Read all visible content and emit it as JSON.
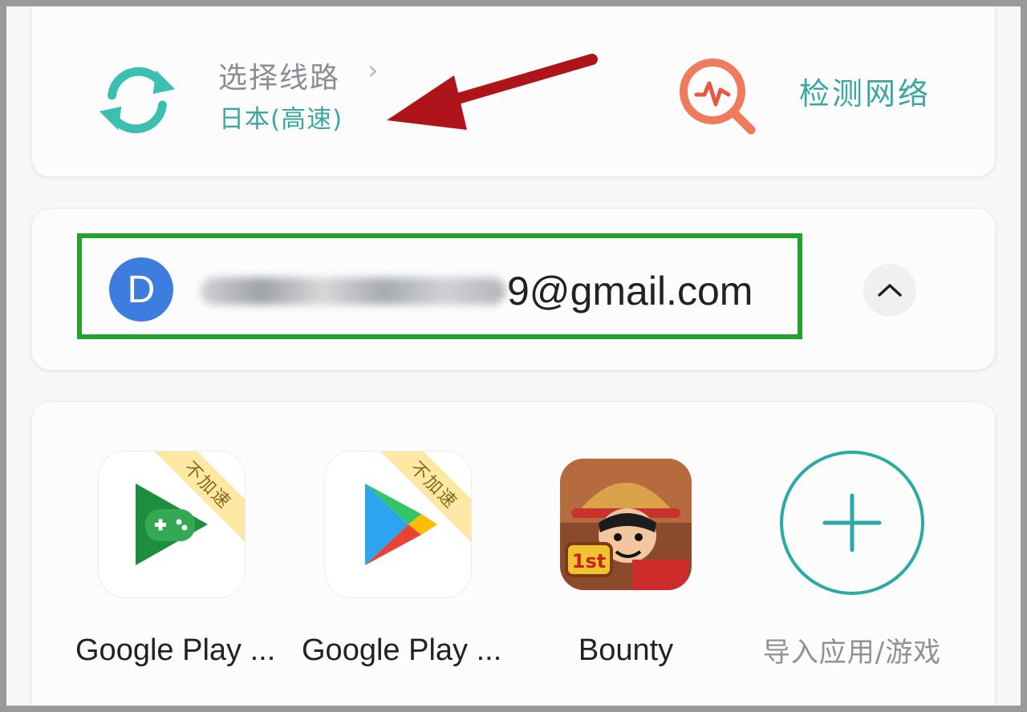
{
  "route": {
    "title": "选择线路",
    "chevron": "›",
    "selected": "日本(高速)",
    "icon": "refresh-cycle-icon"
  },
  "network": {
    "label": "检测网络",
    "icon": "network-test-icon"
  },
  "account": {
    "avatar_letter": "D",
    "email_domain": "9@gmail.com",
    "email_note": "username blurred",
    "collapse_icon": "chevron-up-icon"
  },
  "apps": [
    {
      "name": "Google Play ...",
      "badge": "不加速",
      "icon": "google-play-games-icon"
    },
    {
      "name": "Google Play ...",
      "badge": "不加速",
      "icon": "google-play-store-icon"
    },
    {
      "name": "Bounty",
      "icon": "bounty-game-icon"
    },
    {
      "name": "导入应用/游戏",
      "icon": "plus-icon"
    }
  ],
  "colors": {
    "teal": "#3aa7a4",
    "highlight_green": "#1fa32a",
    "arrow_red": "#b0141b",
    "avatar_blue": "#3e7de0"
  }
}
